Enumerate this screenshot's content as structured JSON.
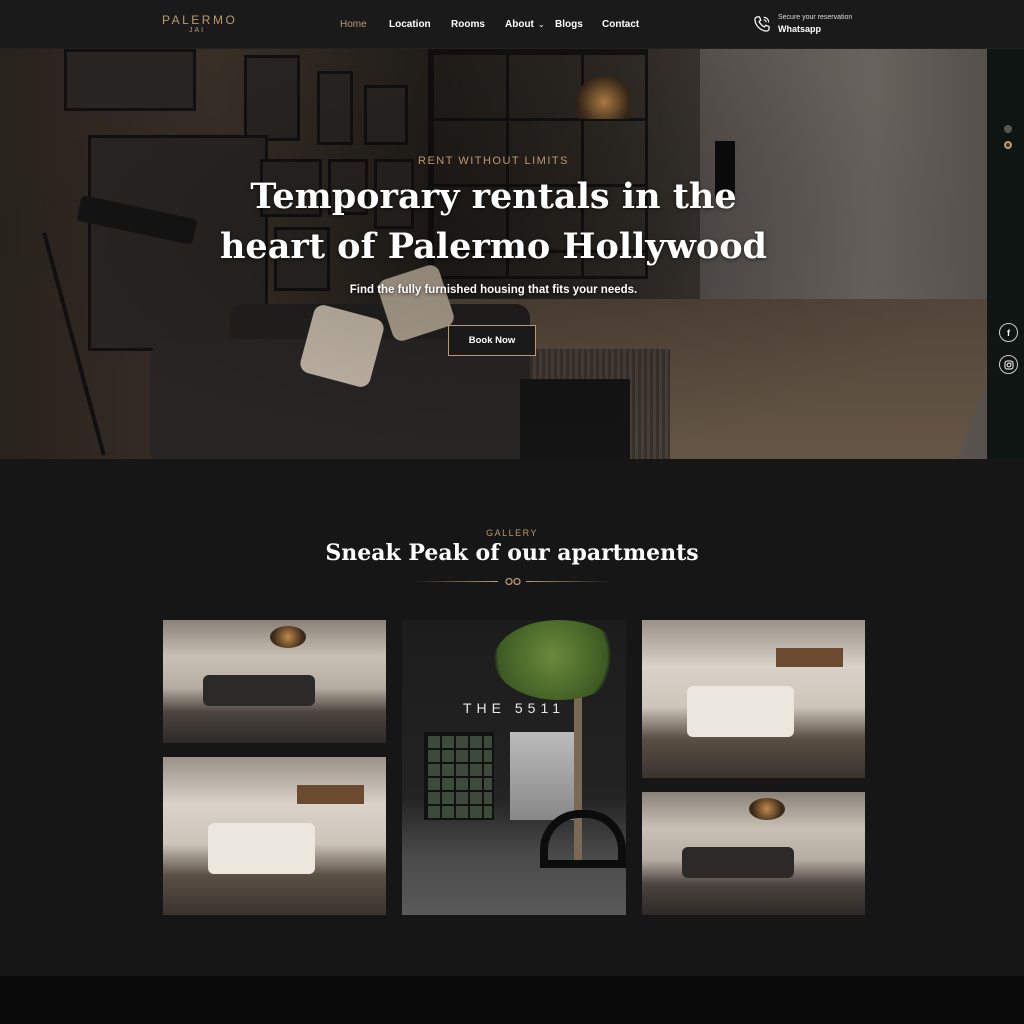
{
  "header": {
    "logo_line1": "PALERMO",
    "logo_line2": "JAI",
    "nav": [
      "Home",
      "Location",
      "Rooms",
      "About",
      "Blogs",
      "Contact"
    ],
    "active_nav": "Home",
    "reservation_small": "Secure your reservation",
    "reservation_big": "Whatsapp"
  },
  "hero": {
    "subtitle": "RENT WITHOUT LIMITS",
    "title_line1": "Temporary rentals in the",
    "title_line2": "heart of Palermo Hollywood",
    "description": "Find the fully furnished housing that fits your needs.",
    "cta": "Book Now"
  },
  "side_rail": {
    "social": [
      "facebook-icon",
      "instagram-icon"
    ]
  },
  "gallery": {
    "label": "GALLERY",
    "title": "Sneak Peak of our apartments",
    "building_sign": "THE 5511",
    "photos": [
      "living-room",
      "bedroom",
      "building-exterior",
      "bedroom",
      "living-room"
    ]
  },
  "colors": {
    "accent": "#b99a72",
    "background": "#161616",
    "header": "#1a1a1a"
  }
}
